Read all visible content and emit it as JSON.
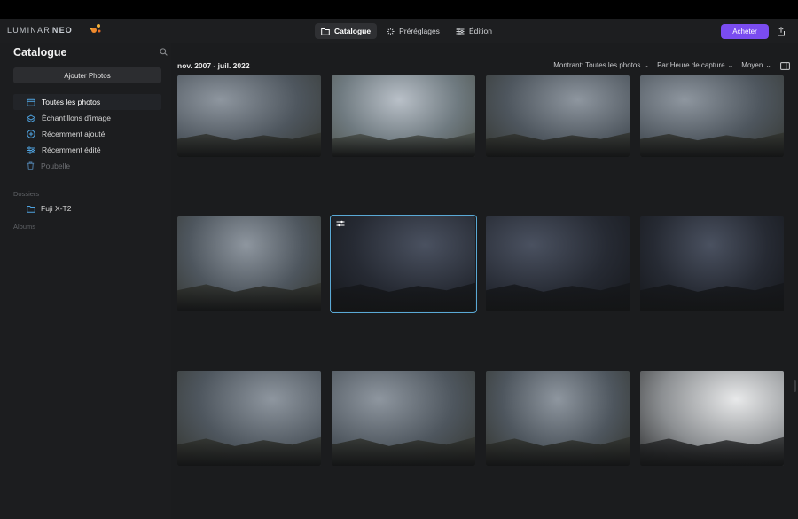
{
  "app": {
    "logo_text": "LUMINAR",
    "logo_neo": "NEO"
  },
  "nav": {
    "tabs": [
      {
        "label": "Catalogue",
        "icon": "folder-icon",
        "active": true
      },
      {
        "label": "Préréglages",
        "icon": "sparkle-icon",
        "active": false
      },
      {
        "label": "Édition",
        "icon": "sliders-icon",
        "active": false
      }
    ]
  },
  "header": {
    "buy_label": "Acheter",
    "accent_color": "#7a4cf0"
  },
  "sidebar": {
    "title": "Catalogue",
    "add_photos_label": "Ajouter Photos",
    "items": [
      {
        "label": "Toutes les photos",
        "icon": "photos-icon",
        "active": true
      },
      {
        "label": "Échantillons d’image",
        "icon": "samples-icon",
        "active": false
      },
      {
        "label": "Récemment ajouté",
        "icon": "plus-circle-icon",
        "active": false
      },
      {
        "label": "Récemment édité",
        "icon": "sliders-icon",
        "active": false
      },
      {
        "label": "Poubelle",
        "icon": "trash-icon",
        "active": false
      }
    ],
    "folders_label": "Dossiers",
    "folder_item": "Fuji X-T2",
    "albums_label": "Albums"
  },
  "toolbar": {
    "date_range": "nov. 2007 - juil. 2022",
    "showing": "Montrant: Toutes les photos",
    "sort": "Par Heure de capture",
    "size": "Moyen"
  },
  "photos": [
    {
      "row": 0,
      "col": 0,
      "tone": "mid",
      "selected": false,
      "edited": false
    },
    {
      "row": 0,
      "col": 1,
      "tone": "light",
      "selected": false,
      "edited": false
    },
    {
      "row": 0,
      "col": 2,
      "tone": "mid",
      "selected": false,
      "edited": false
    },
    {
      "row": 0,
      "col": 3,
      "tone": "mid",
      "selected": false,
      "edited": false
    },
    {
      "row": 1,
      "col": 0,
      "tone": "mid",
      "selected": false,
      "edited": false
    },
    {
      "row": 1,
      "col": 1,
      "tone": "dark",
      "selected": true,
      "edited": true
    },
    {
      "row": 1,
      "col": 2,
      "tone": "dark",
      "selected": false,
      "edited": false
    },
    {
      "row": 1,
      "col": 3,
      "tone": "dark",
      "selected": false,
      "edited": false
    },
    {
      "row": 2,
      "col": 0,
      "tone": "mid",
      "selected": false,
      "edited": false
    },
    {
      "row": 2,
      "col": 1,
      "tone": "mid",
      "selected": false,
      "edited": false
    },
    {
      "row": 2,
      "col": 2,
      "tone": "mid",
      "selected": false,
      "edited": false
    },
    {
      "row": 2,
      "col": 3,
      "tone": "bright",
      "selected": false,
      "edited": false
    }
  ]
}
